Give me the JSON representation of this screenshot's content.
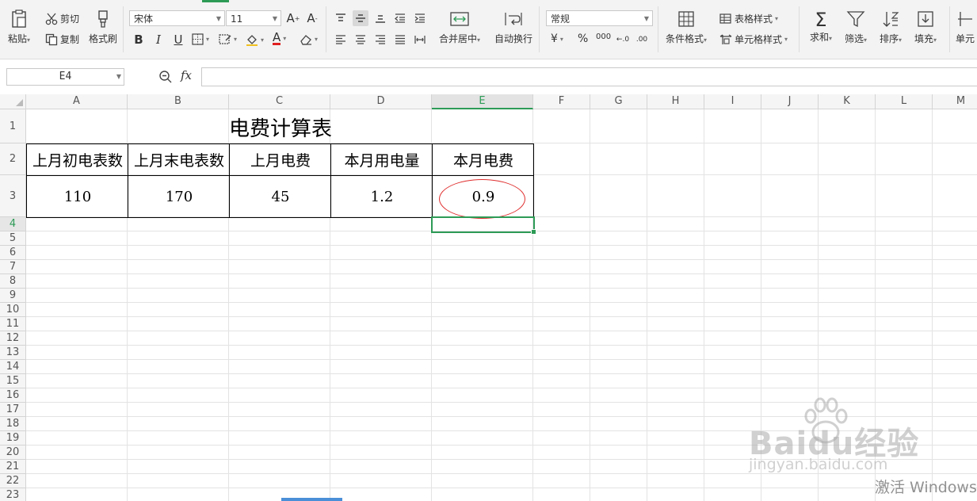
{
  "ribbon": {
    "paste": "粘贴",
    "cut": "剪切",
    "copy": "复制",
    "format_painter": "格式刷",
    "font_name": "宋体",
    "font_size": "11",
    "bold": "B",
    "italic": "I",
    "underline": "U",
    "merge_center": "合并居中",
    "wrap_text": "自动换行",
    "number_format": "常规",
    "currency": "¥",
    "percent": "%",
    "thousands": "000",
    "cond_format": "条件格式",
    "table_style": "表格样式",
    "cell_style": "单元格样式",
    "sum": "求和",
    "filter": "筛选",
    "sort": "排序",
    "fill": "填充",
    "cell_more": "单元",
    "accent_color": "#2d9b56",
    "font_color": "#e02020"
  },
  "formula_bar": {
    "name_box": "E4",
    "fx_label": "fx",
    "formula": ""
  },
  "grid": {
    "columns": [
      "A",
      "B",
      "C",
      "D",
      "E",
      "F",
      "G",
      "H",
      "I",
      "J",
      "K",
      "L",
      "M"
    ],
    "rows": [
      "1",
      "2",
      "3",
      "4",
      "5",
      "6",
      "7",
      "8",
      "9",
      "10",
      "11",
      "12",
      "13",
      "14",
      "15",
      "16",
      "17",
      "18",
      "19",
      "20",
      "21",
      "22",
      "23"
    ],
    "selected_cell": "E4"
  },
  "sheet": {
    "title": "电费计算表",
    "headers": [
      "上月初电表数",
      "上月末电表数",
      "上月电费",
      "本月用电量",
      "本月电费"
    ],
    "values": [
      "110",
      "170",
      "45",
      "1.2",
      "0.9"
    ]
  },
  "overlay": {
    "watermark": "Baidu经验",
    "watermark_url": "jingyan.baidu.com",
    "activate_windows": "激活 Windows"
  }
}
